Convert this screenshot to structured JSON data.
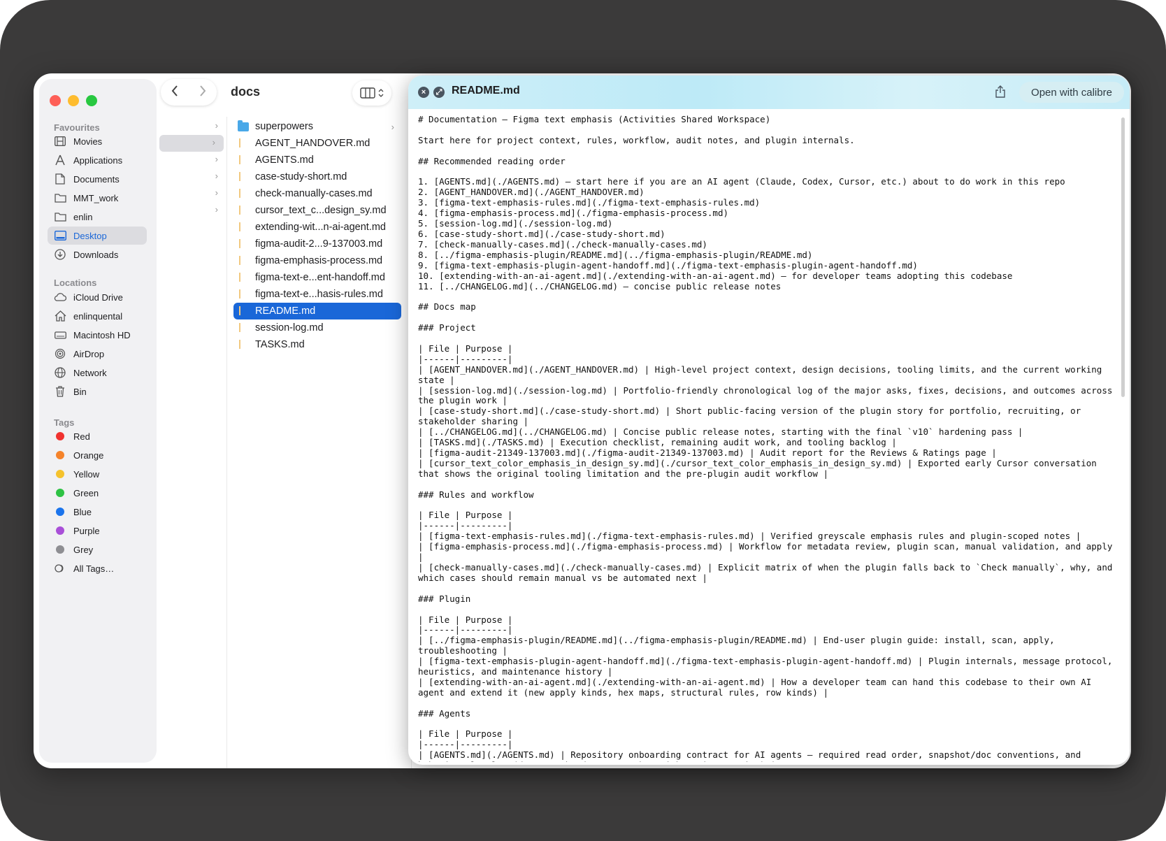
{
  "sidebar": {
    "favourites_heading": "Favourites",
    "favourites": [
      {
        "label": "Movies",
        "icon": "film-icon"
      },
      {
        "label": "Applications",
        "icon": "applications-icon"
      },
      {
        "label": "Documents",
        "icon": "document-icon"
      },
      {
        "label": "MMT_work",
        "icon": "folder-icon"
      },
      {
        "label": "enlin",
        "icon": "folder-icon"
      },
      {
        "label": "Desktop",
        "icon": "desktop-icon",
        "selected": true
      },
      {
        "label": "Downloads",
        "icon": "downloads-icon"
      }
    ],
    "locations_heading": "Locations",
    "locations": [
      {
        "label": "iCloud Drive",
        "icon": "cloud-icon"
      },
      {
        "label": "enlinquental",
        "icon": "home-icon"
      },
      {
        "label": "Macintosh HD",
        "icon": "disk-icon"
      },
      {
        "label": "AirDrop",
        "icon": "airdrop-icon"
      },
      {
        "label": "Network",
        "icon": "globe-icon"
      },
      {
        "label": "Bin",
        "icon": "trash-icon"
      }
    ],
    "tags_heading": "Tags",
    "tags": [
      {
        "label": "Red",
        "color": "#f0322f"
      },
      {
        "label": "Orange",
        "color": "#f5832a"
      },
      {
        "label": "Yellow",
        "color": "#f5c22c"
      },
      {
        "label": "Green",
        "color": "#2ec244"
      },
      {
        "label": "Blue",
        "color": "#1b74ec"
      },
      {
        "label": "Purple",
        "color": "#a94fd8"
      },
      {
        "label": "Grey",
        "color": "#8e8e92"
      },
      {
        "label": "All Tags…",
        "icon": "all-tags-icon"
      }
    ]
  },
  "toolbar": {
    "back_icon": "chevron-left-icon",
    "forward_icon": "chevron-right-icon",
    "title": "docs",
    "view_icon": "column-view-icon"
  },
  "files": [
    {
      "name": "superpowers",
      "type": "folder"
    },
    {
      "name": "AGENT_HANDOVER.md",
      "type": "md"
    },
    {
      "name": "AGENTS.md",
      "type": "md"
    },
    {
      "name": "case-study-short.md",
      "type": "md"
    },
    {
      "name": "check-manually-cases.md",
      "type": "md"
    },
    {
      "name": "cursor_text_c...design_sy.md",
      "type": "md"
    },
    {
      "name": "extending-wit...n-ai-agent.md",
      "type": "md"
    },
    {
      "name": "figma-audit-2...9-137003.md",
      "type": "md"
    },
    {
      "name": "figma-emphasis-process.md",
      "type": "md"
    },
    {
      "name": "figma-text-e...ent-handoff.md",
      "type": "md"
    },
    {
      "name": "figma-text-e...hasis-rules.md",
      "type": "md"
    },
    {
      "name": "README.md",
      "type": "md",
      "selected": true
    },
    {
      "name": "session-log.md",
      "type": "md"
    },
    {
      "name": "TASKS.md",
      "type": "md"
    }
  ],
  "quicklook": {
    "title": "README.md",
    "open_with_label": "Open with calibre",
    "accent_color": "#c6ecf7",
    "content": "# Documentation — Figma text emphasis (Activities Shared Workspace)\n\nStart here for project context, rules, workflow, audit notes, and plugin internals.\n\n## Recommended reading order\n\n1. [AGENTS.md](./AGENTS.md) — start here if you are an AI agent (Claude, Codex, Cursor, etc.) about to do work in this repo\n2. [AGENT_HANDOVER.md](./AGENT_HANDOVER.md)\n3. [figma-text-emphasis-rules.md](./figma-text-emphasis-rules.md)\n4. [figma-emphasis-process.md](./figma-emphasis-process.md)\n5. [session-log.md](./session-log.md)\n6. [case-study-short.md](./case-study-short.md)\n7. [check-manually-cases.md](./check-manually-cases.md)\n8. [../figma-emphasis-plugin/README.md](../figma-emphasis-plugin/README.md)\n9. [figma-text-emphasis-plugin-agent-handoff.md](./figma-text-emphasis-plugin-agent-handoff.md)\n10. [extending-with-an-ai-agent.md](./extending-with-an-ai-agent.md) — for developer teams adopting this codebase\n11. [../CHANGELOG.md](../CHANGELOG.md) — concise public release notes\n\n## Docs map\n\n### Project\n\n| File | Purpose |\n|------|---------|\n| [AGENT_HANDOVER.md](./AGENT_HANDOVER.md) | High-level project context, design decisions, tooling limits, and the current working state |\n| [session-log.md](./session-log.md) | Portfolio-friendly chronological log of the major asks, fixes, decisions, and outcomes across the plugin work |\n| [case-study-short.md](./case-study-short.md) | Short public-facing version of the plugin story for portfolio, recruiting, or stakeholder sharing |\n| [../CHANGELOG.md](../CHANGELOG.md) | Concise public release notes, starting with the final `v10` hardening pass |\n| [TASKS.md](./TASKS.md) | Execution checklist, remaining audit work, and tooling backlog |\n| [figma-audit-21349-137003.md](./figma-audit-21349-137003.md) | Audit report for the Reviews & Ratings page |\n| [cursor_text_color_emphasis_in_design_sy.md](./cursor_text_color_emphasis_in_design_sy.md) | Exported early Cursor conversation that shows the original tooling limitation and the pre-plugin audit workflow |\n\n### Rules and workflow\n\n| File | Purpose |\n|------|---------|\n| [figma-text-emphasis-rules.md](./figma-text-emphasis-rules.md) | Verified greyscale emphasis rules and plugin-scoped notes |\n| [figma-emphasis-process.md](./figma-emphasis-process.md) | Workflow for metadata review, plugin scan, manual validation, and apply |\n| [check-manually-cases.md](./check-manually-cases.md) | Explicit matrix of when the plugin falls back to `Check manually`, why, and which cases should remain manual vs be automated next |\n\n### Plugin\n\n| File | Purpose |\n|------|---------|\n| [../figma-emphasis-plugin/README.md](../figma-emphasis-plugin/README.md) | End-user plugin guide: install, scan, apply, troubleshooting |\n| [figma-text-emphasis-plugin-agent-handoff.md](./figma-text-emphasis-plugin-agent-handoff.md) | Plugin internals, message protocol, heuristics, and maintenance history |\n| [extending-with-an-ai-agent.md](./extending-with-an-ai-agent.md) | How a developer team can hand this codebase to their own AI agent and extend it (new apply kinds, hex maps, structural rules, row kinds) |\n\n### Agents\n\n| File | Purpose |\n|------|---------|\n| [AGENTS.md](./AGENTS.md) | Repository onboarding contract for AI agents — required read order, snapshot/doc conventions, and behavioural rules (don't push, don't snapshot without instruction) |"
  }
}
